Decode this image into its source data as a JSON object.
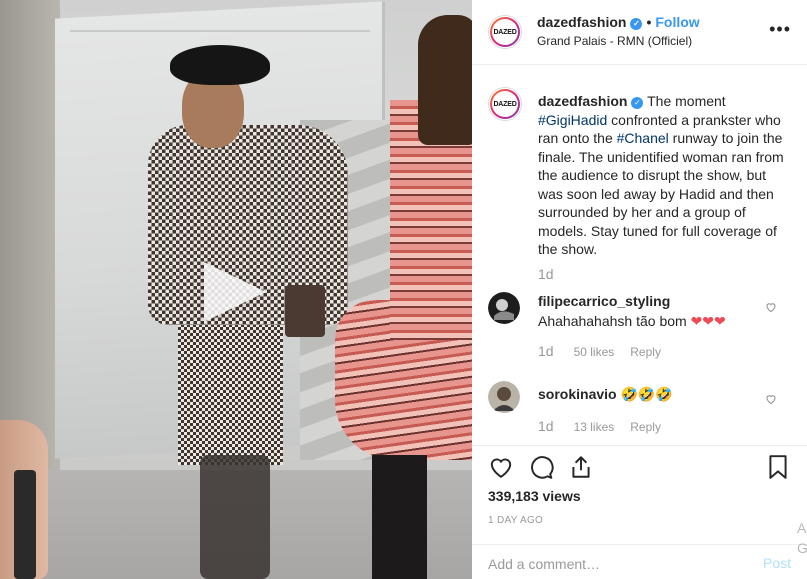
{
  "post": {
    "username": "dazedfashion",
    "follow_label": "Follow",
    "location": "Grand Palais - RMN (Officiel)",
    "avatar_text": "DAZED",
    "more_label": "•••"
  },
  "caption": {
    "username": "dazedfashion",
    "text_1": " The moment ",
    "tag_1": "#GigiHadid",
    "text_2": " confronted a prankster who ran onto the ",
    "tag_2": "#Chanel",
    "text_3": " runway to join the finale. The unidentified woman ran from the audience to disrupt the show, but was soon led away by Hadid and then surrounded by her and a group of models. Stay tuned for full coverage of the show.",
    "time": "1d"
  },
  "comments": [
    {
      "username": "filipecarrico_styling",
      "text": "Ahahahahahsh tão bom ",
      "emoji": "❤❤❤",
      "time": "1d",
      "likes": "50 likes",
      "reply": "Reply"
    },
    {
      "username": "sorokinavio",
      "text": "",
      "emoji": "🤣🤣🤣",
      "time": "1d",
      "likes": "13 likes",
      "reply": "Reply"
    }
  ],
  "stats": {
    "views": "339,183 views",
    "date": "1 DAY AGO"
  },
  "add_comment": {
    "placeholder": "Add a comment…",
    "post_label": "Post"
  },
  "edge": {
    "text": "A G"
  },
  "colors": {
    "link_blue": "#3897f0",
    "hashtag": "#003569",
    "muted": "#999999",
    "heart_red": "#ed4956"
  }
}
